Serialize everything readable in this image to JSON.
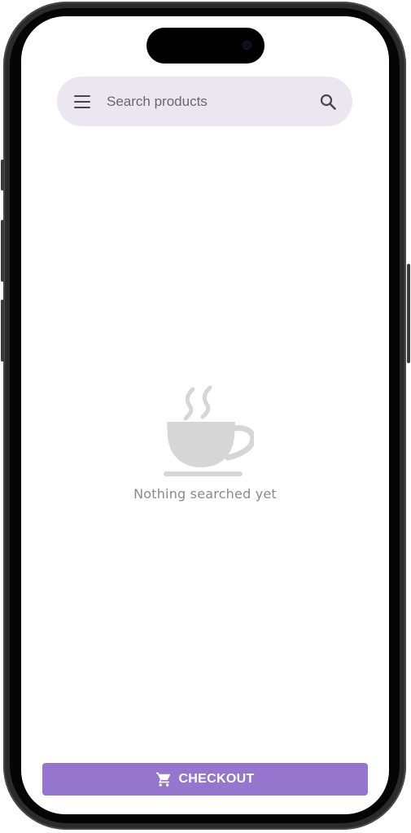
{
  "search": {
    "placeholder": "Search products",
    "menu_icon": "menu-icon",
    "search_icon": "search-icon"
  },
  "empty_state": {
    "icon": "coffee-cup-icon",
    "message": "Nothing searched yet"
  },
  "checkout": {
    "icon": "shopping-cart-icon",
    "label": "CHECKOUT"
  },
  "colors": {
    "search_bar_bg": "#ece6f0",
    "checkout_bg": "#9575cd",
    "empty_icon": "#d6d6d6",
    "empty_text": "#8a8a8a"
  }
}
